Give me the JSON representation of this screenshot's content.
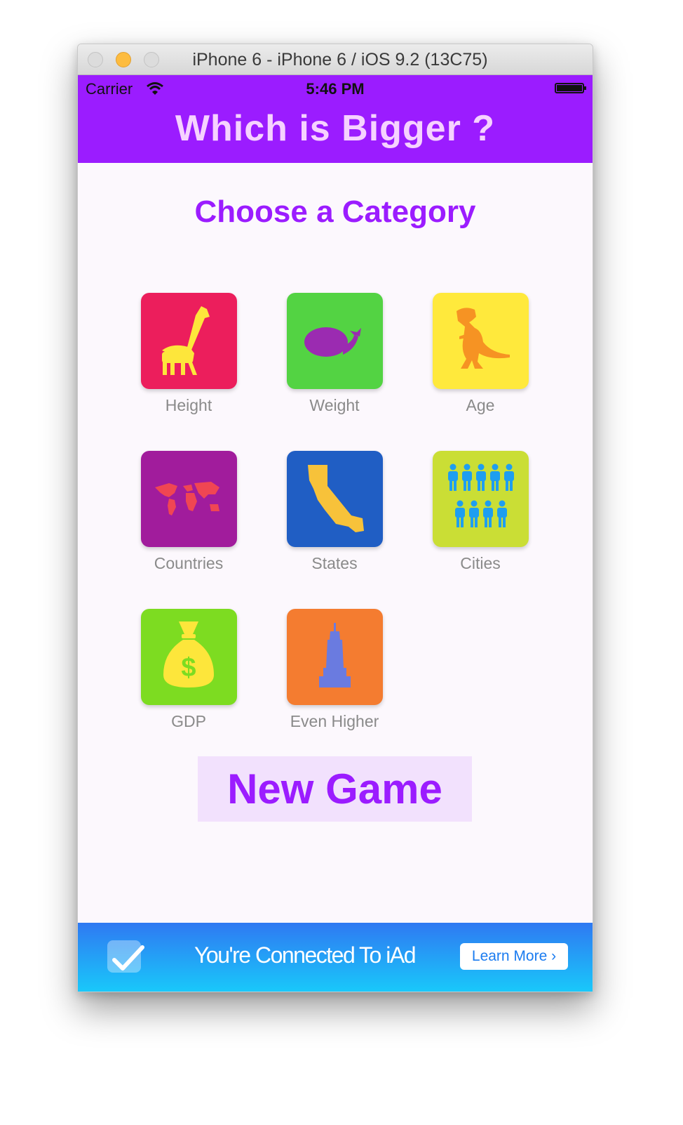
{
  "window": {
    "title": "iPhone 6 - iPhone 6 / iOS 9.2 (13C75)"
  },
  "status_bar": {
    "carrier": "Carrier",
    "time": "5:46 PM"
  },
  "app": {
    "title": "Which is Bigger ?"
  },
  "main": {
    "heading": "Choose a Category",
    "categories": [
      {
        "label": "Height",
        "icon": "giraffe-icon",
        "color": "#ec1e5c",
        "icon_color": "#fde63b"
      },
      {
        "label": "Weight",
        "icon": "whale-icon",
        "color": "#53d343",
        "icon_color": "#9b2bb1"
      },
      {
        "label": "Age",
        "icon": "dinosaur-icon",
        "color": "#ffe93c",
        "icon_color": "#f69323"
      },
      {
        "label": "Countries",
        "icon": "world-map-icon",
        "color": "#a11c9c",
        "icon_color": "#f04653"
      },
      {
        "label": "States",
        "icon": "california-icon",
        "color": "#205ec4",
        "icon_color": "#f7c23a"
      },
      {
        "label": "Cities",
        "icon": "people-icon",
        "color": "#cade35",
        "icon_color": "#1e9ef0"
      },
      {
        "label": "GDP",
        "icon": "money-bag-icon",
        "color": "#7ddc21",
        "icon_color": "#fde63b"
      },
      {
        "label": "Even Higher",
        "icon": "skyscraper-icon",
        "color": "#f47c30",
        "icon_color": "#6a7be0"
      }
    ],
    "new_game_label": "New Game"
  },
  "ad_banner": {
    "text": "You're Connected To iAd",
    "button_label": "Learn More ›"
  }
}
